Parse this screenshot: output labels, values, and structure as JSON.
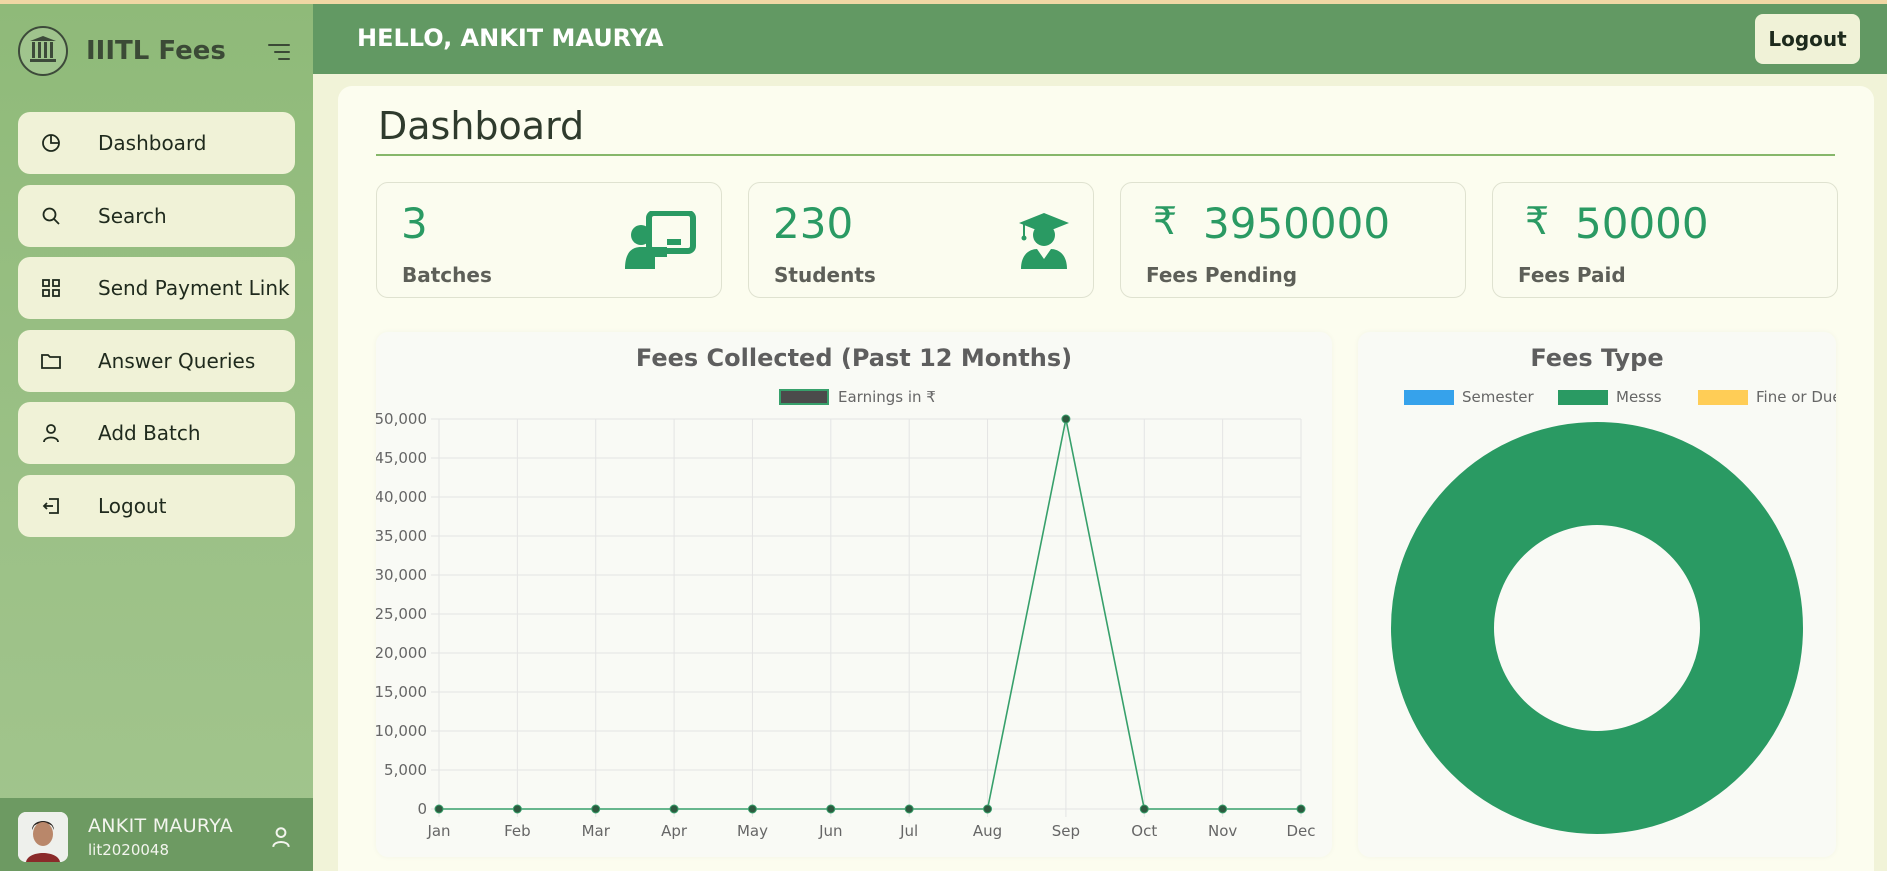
{
  "brand": {
    "name": "IIITL Fees"
  },
  "nav": {
    "items": [
      {
        "label": "Dashboard",
        "icon": "pie-chart-icon"
      },
      {
        "label": "Search",
        "icon": "search-icon"
      },
      {
        "label": "Send Payment Link",
        "icon": "grid-icon"
      },
      {
        "label": "Answer Queries",
        "icon": "folder-icon"
      },
      {
        "label": "Add Batch",
        "icon": "user-icon"
      },
      {
        "label": "Logout",
        "icon": "logout-icon"
      }
    ]
  },
  "user": {
    "name": "ANKIT MAURYA",
    "id": "lit2020048"
  },
  "header": {
    "greeting": "HELLO, ANKIT MAURYA",
    "logout_label": "Logout"
  },
  "page": {
    "title": "Dashboard"
  },
  "stats": [
    {
      "value": "3",
      "label": "Batches",
      "icon": "teacher-board-icon"
    },
    {
      "value": "230",
      "label": "Students",
      "icon": "graduate-icon"
    },
    {
      "currency": "₹",
      "value": "3950000",
      "label": "Fees Pending"
    },
    {
      "currency": "₹",
      "value": "50000",
      "label": "Fees Paid"
    }
  ],
  "colors": {
    "accent": "#2a9a63",
    "line": "#37a06b",
    "semester": "#36a2eb",
    "mess": "#2a9a63",
    "fine": "#ffcd56"
  },
  "chart_data": [
    {
      "type": "line",
      "title": "Fees Collected (Past 12 Months)",
      "categories": [
        "Jan",
        "Feb",
        "Mar",
        "Apr",
        "May",
        "Jun",
        "Jul",
        "Aug",
        "Sep",
        "Oct",
        "Nov",
        "Dec"
      ],
      "series": [
        {
          "name": "Earnings in ₹",
          "values": [
            0,
            0,
            0,
            0,
            0,
            0,
            0,
            0,
            50000,
            0,
            0,
            0
          ]
        }
      ],
      "ylim": [
        0,
        50000
      ],
      "yticks": [
        "0",
        "5,000",
        "10,000",
        "15,000",
        "20,000",
        "25,000",
        "30,000",
        "35,000",
        "40,000",
        "45,000",
        "50,000"
      ],
      "grid": true,
      "legend": "top"
    },
    {
      "type": "pie",
      "title": "Fees Type",
      "labels": [
        "Semester",
        "Messs",
        "Fine or Due"
      ],
      "values": [
        0,
        50000,
        0
      ],
      "legend": "top"
    }
  ]
}
